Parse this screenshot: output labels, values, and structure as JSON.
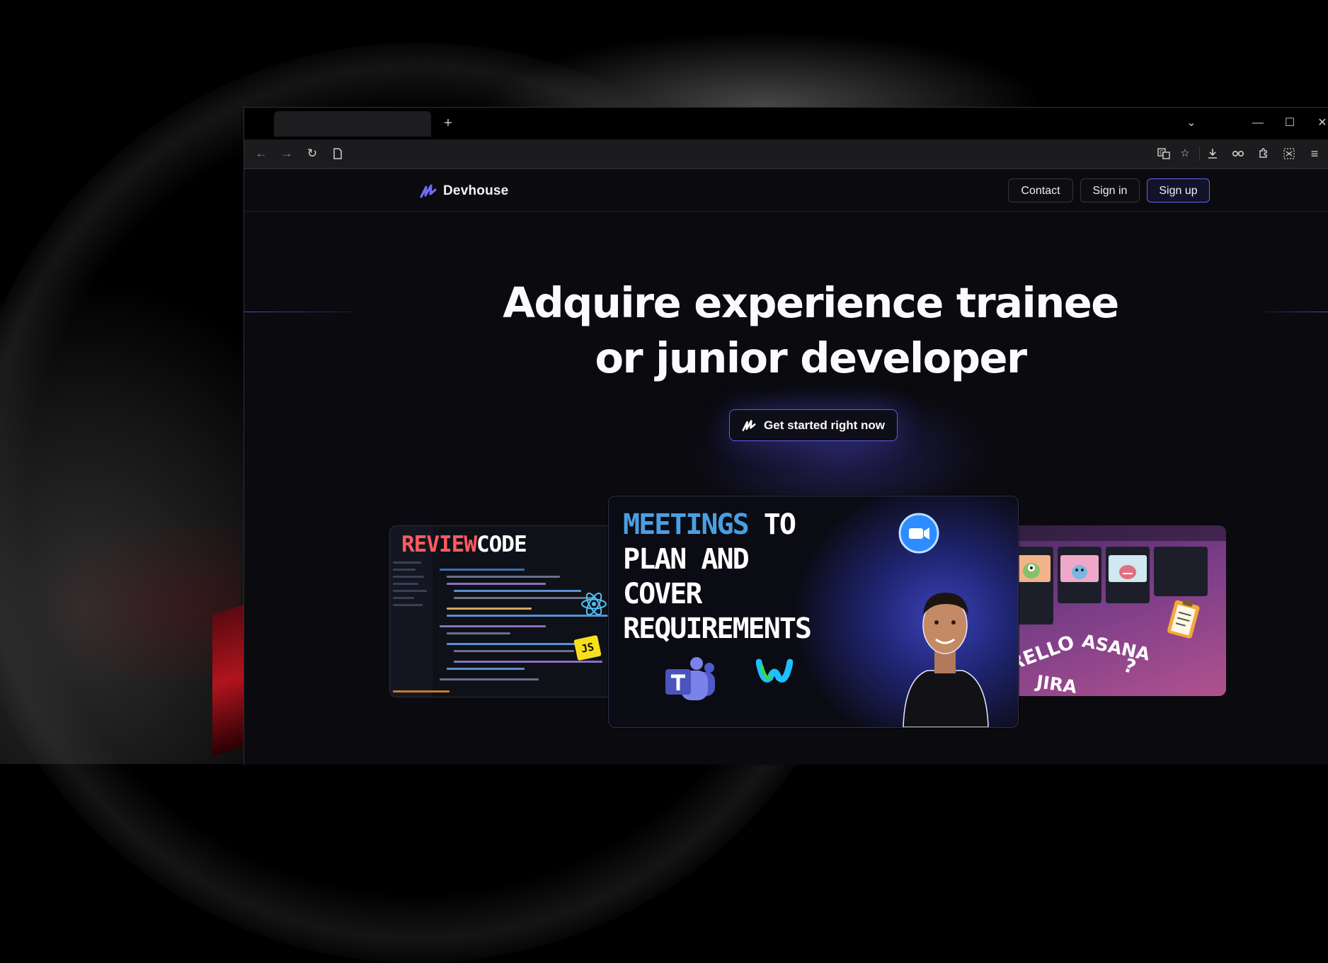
{
  "browser": {
    "tab_title": "",
    "new_tab_label": "+",
    "dropdown_label": "⌄",
    "minimize_label": "—",
    "maximize_label": "☐",
    "close_label": "✕",
    "back_label": "←",
    "forward_label": "→",
    "reload_label": "↻",
    "address_value": "",
    "menu_label": "≡"
  },
  "site": {
    "brand": "Devhouse",
    "nav": {
      "contact": "Contact",
      "sign_in": "Sign in",
      "sign_up": "Sign up"
    },
    "hero": {
      "title_line1": "Adquire experience trainee",
      "title_line2": "or junior developer",
      "cta": "Get started right now"
    },
    "cards": {
      "left": {
        "title_red": "REVIEW",
        "title_white": "CODE",
        "js_badge": "JS"
      },
      "center": {
        "title_blue": "MEETINGS",
        "title_rest_1": " TO",
        "title_rest_2": "PLAN AND",
        "title_rest_3": "COVER",
        "title_rest_4": "REQUIREMENTS"
      },
      "right": {
        "word_1": "TRELLO",
        "word_2": "ASANA",
        "word_3": "JIRA",
        "word_4": "?"
      }
    }
  },
  "colors": {
    "accent": "#6366f1",
    "page_bg": "#0a0a0f",
    "review_red": "#ff5a5f",
    "meetings_blue": "#4a9fe3",
    "js_yellow": "#f7df1e"
  }
}
